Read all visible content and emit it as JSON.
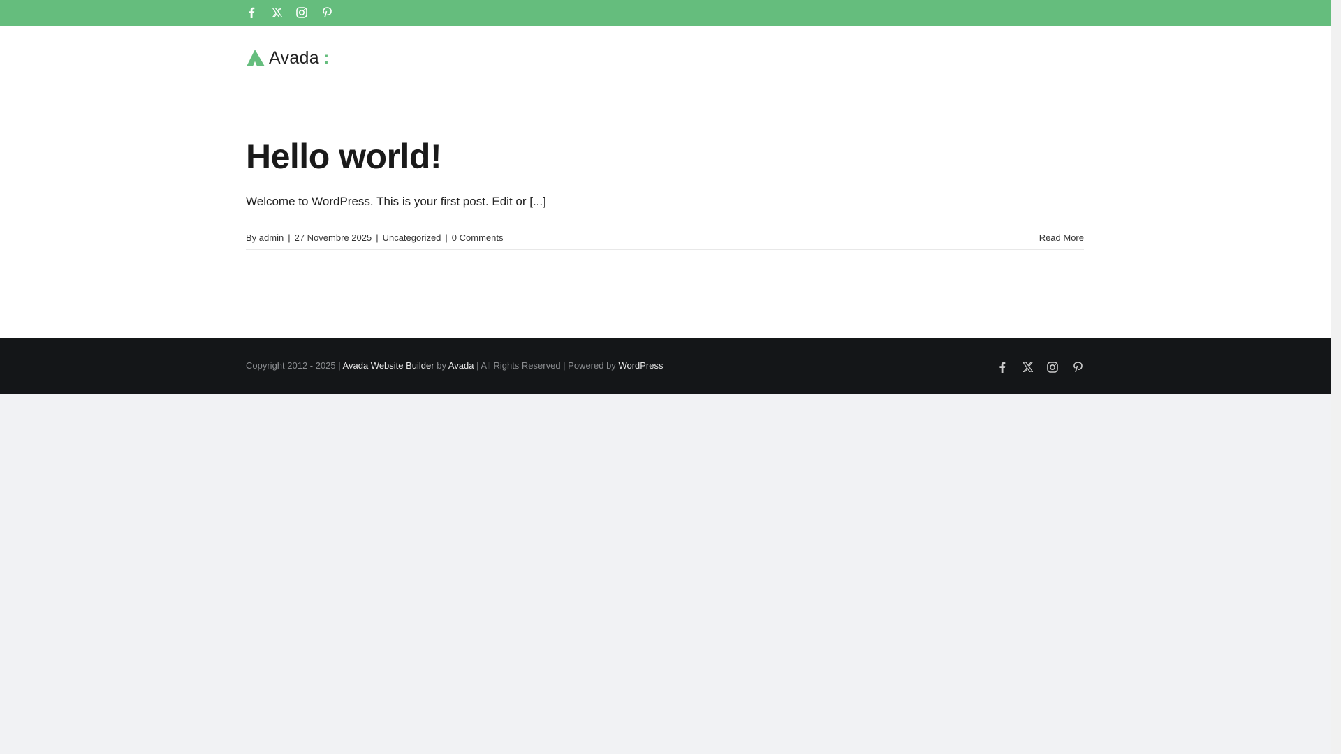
{
  "colors": {
    "accent": "#65bd7d",
    "footer": "#141618"
  },
  "topbar": {
    "social": [
      "facebook-icon",
      "x-twitter-icon",
      "instagram-icon",
      "pinterest-icon"
    ]
  },
  "logo": {
    "text": "Avada"
  },
  "post": {
    "title": "Hello world!",
    "excerpt": "Welcome to WordPress. This is your first post. Edit or [...]",
    "meta": {
      "by": "By",
      "author": "admin",
      "date": "27 Novembre 2025",
      "category": "Uncategorized",
      "comments": "0 Comments",
      "sep": "|"
    },
    "read_more": "Read More"
  },
  "footer": {
    "copyright": "Copyright 2012 - 2025 |",
    "builder": "Avada Website Builder",
    "by": "by",
    "avada": "Avada",
    "rights": "| All Rights Reserved | Powered by",
    "wordpress": "WordPress"
  }
}
